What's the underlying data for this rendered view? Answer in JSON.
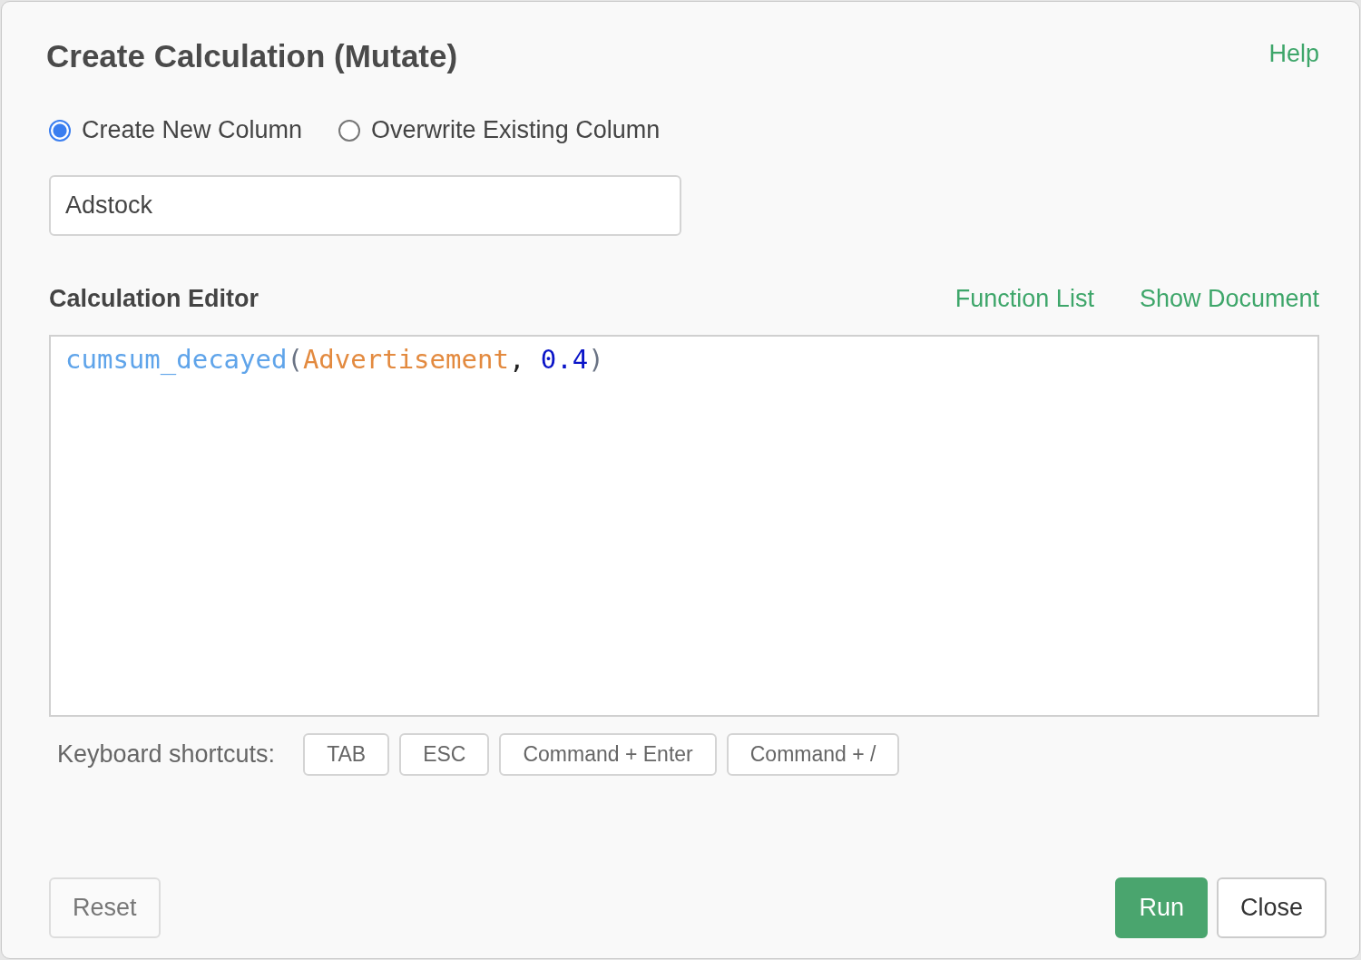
{
  "dialog": {
    "title": "Create Calculation (Mutate)",
    "help_link": "Help"
  },
  "column_mode": [
    {
      "label": "Create New Column",
      "selected": true
    },
    {
      "label": "Overwrite Existing Column",
      "selected": false
    }
  ],
  "column_name": {
    "value": "Adstock"
  },
  "editor": {
    "label": "Calculation Editor",
    "links": [
      "Function List",
      "Show Document"
    ],
    "code": [
      {
        "kind": "function",
        "text": "cumsum_decayed"
      },
      {
        "kind": "paren",
        "text": "("
      },
      {
        "kind": "column",
        "text": "Advertisement"
      },
      {
        "kind": "punct",
        "text": ", "
      },
      {
        "kind": "number",
        "text": "0.4"
      },
      {
        "kind": "paren",
        "text": ")"
      }
    ]
  },
  "shortcuts": {
    "label": "Keyboard shortcuts:",
    "keys": [
      "TAB",
      "ESC",
      "Command + Enter",
      "Command + /"
    ]
  },
  "footer_buttons": [
    {
      "label": "Reset",
      "kind": "secondary"
    },
    {
      "label": "Run",
      "kind": "primary"
    },
    {
      "label": "Close",
      "kind": "default"
    }
  ]
}
